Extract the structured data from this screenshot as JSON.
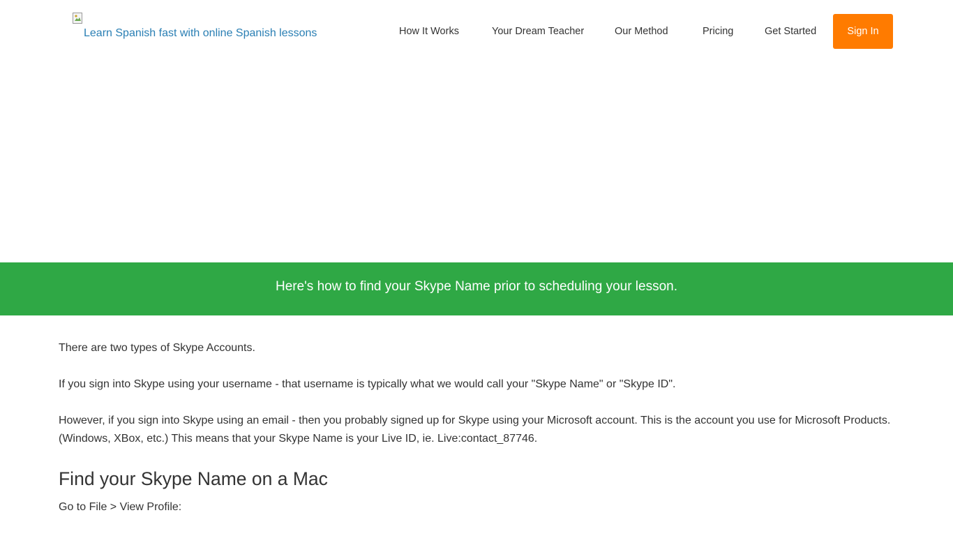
{
  "header": {
    "logo_alt": "Learn Spanish fast with online Spanish lessons",
    "nav": [
      {
        "label": "How It Works"
      },
      {
        "label": "Your Dream Teacher"
      },
      {
        "label": "Our Method"
      },
      {
        "label": "Pricing"
      },
      {
        "label": "Get Started"
      }
    ],
    "signin_label": "Sign In"
  },
  "banner": {
    "text": "Here's how to find your Skype Name prior to scheduling your lesson."
  },
  "content": {
    "paragraphs": [
      "There are two types of Skype Accounts.",
      "If you sign into Skype using your username - that username is typically what we would call your \"Skype Name\" or \"Skype ID\".",
      "However, if you sign into Skype using an email - then you probably signed up for Skype using your Microsoft account. This is the account you use for Microsoft Products. (Windows, XBox, etc.) This means that your Skype Name is your Live ID, ie. Live:contact_87746."
    ],
    "mac_heading": "Find your Skype Name on a Mac",
    "mac_instruction": "Go to File > View Profile:"
  },
  "colors": {
    "accent_orange": "#ff7b00",
    "banner_green": "#2fa845",
    "link_blue": "#2a7fb4"
  }
}
